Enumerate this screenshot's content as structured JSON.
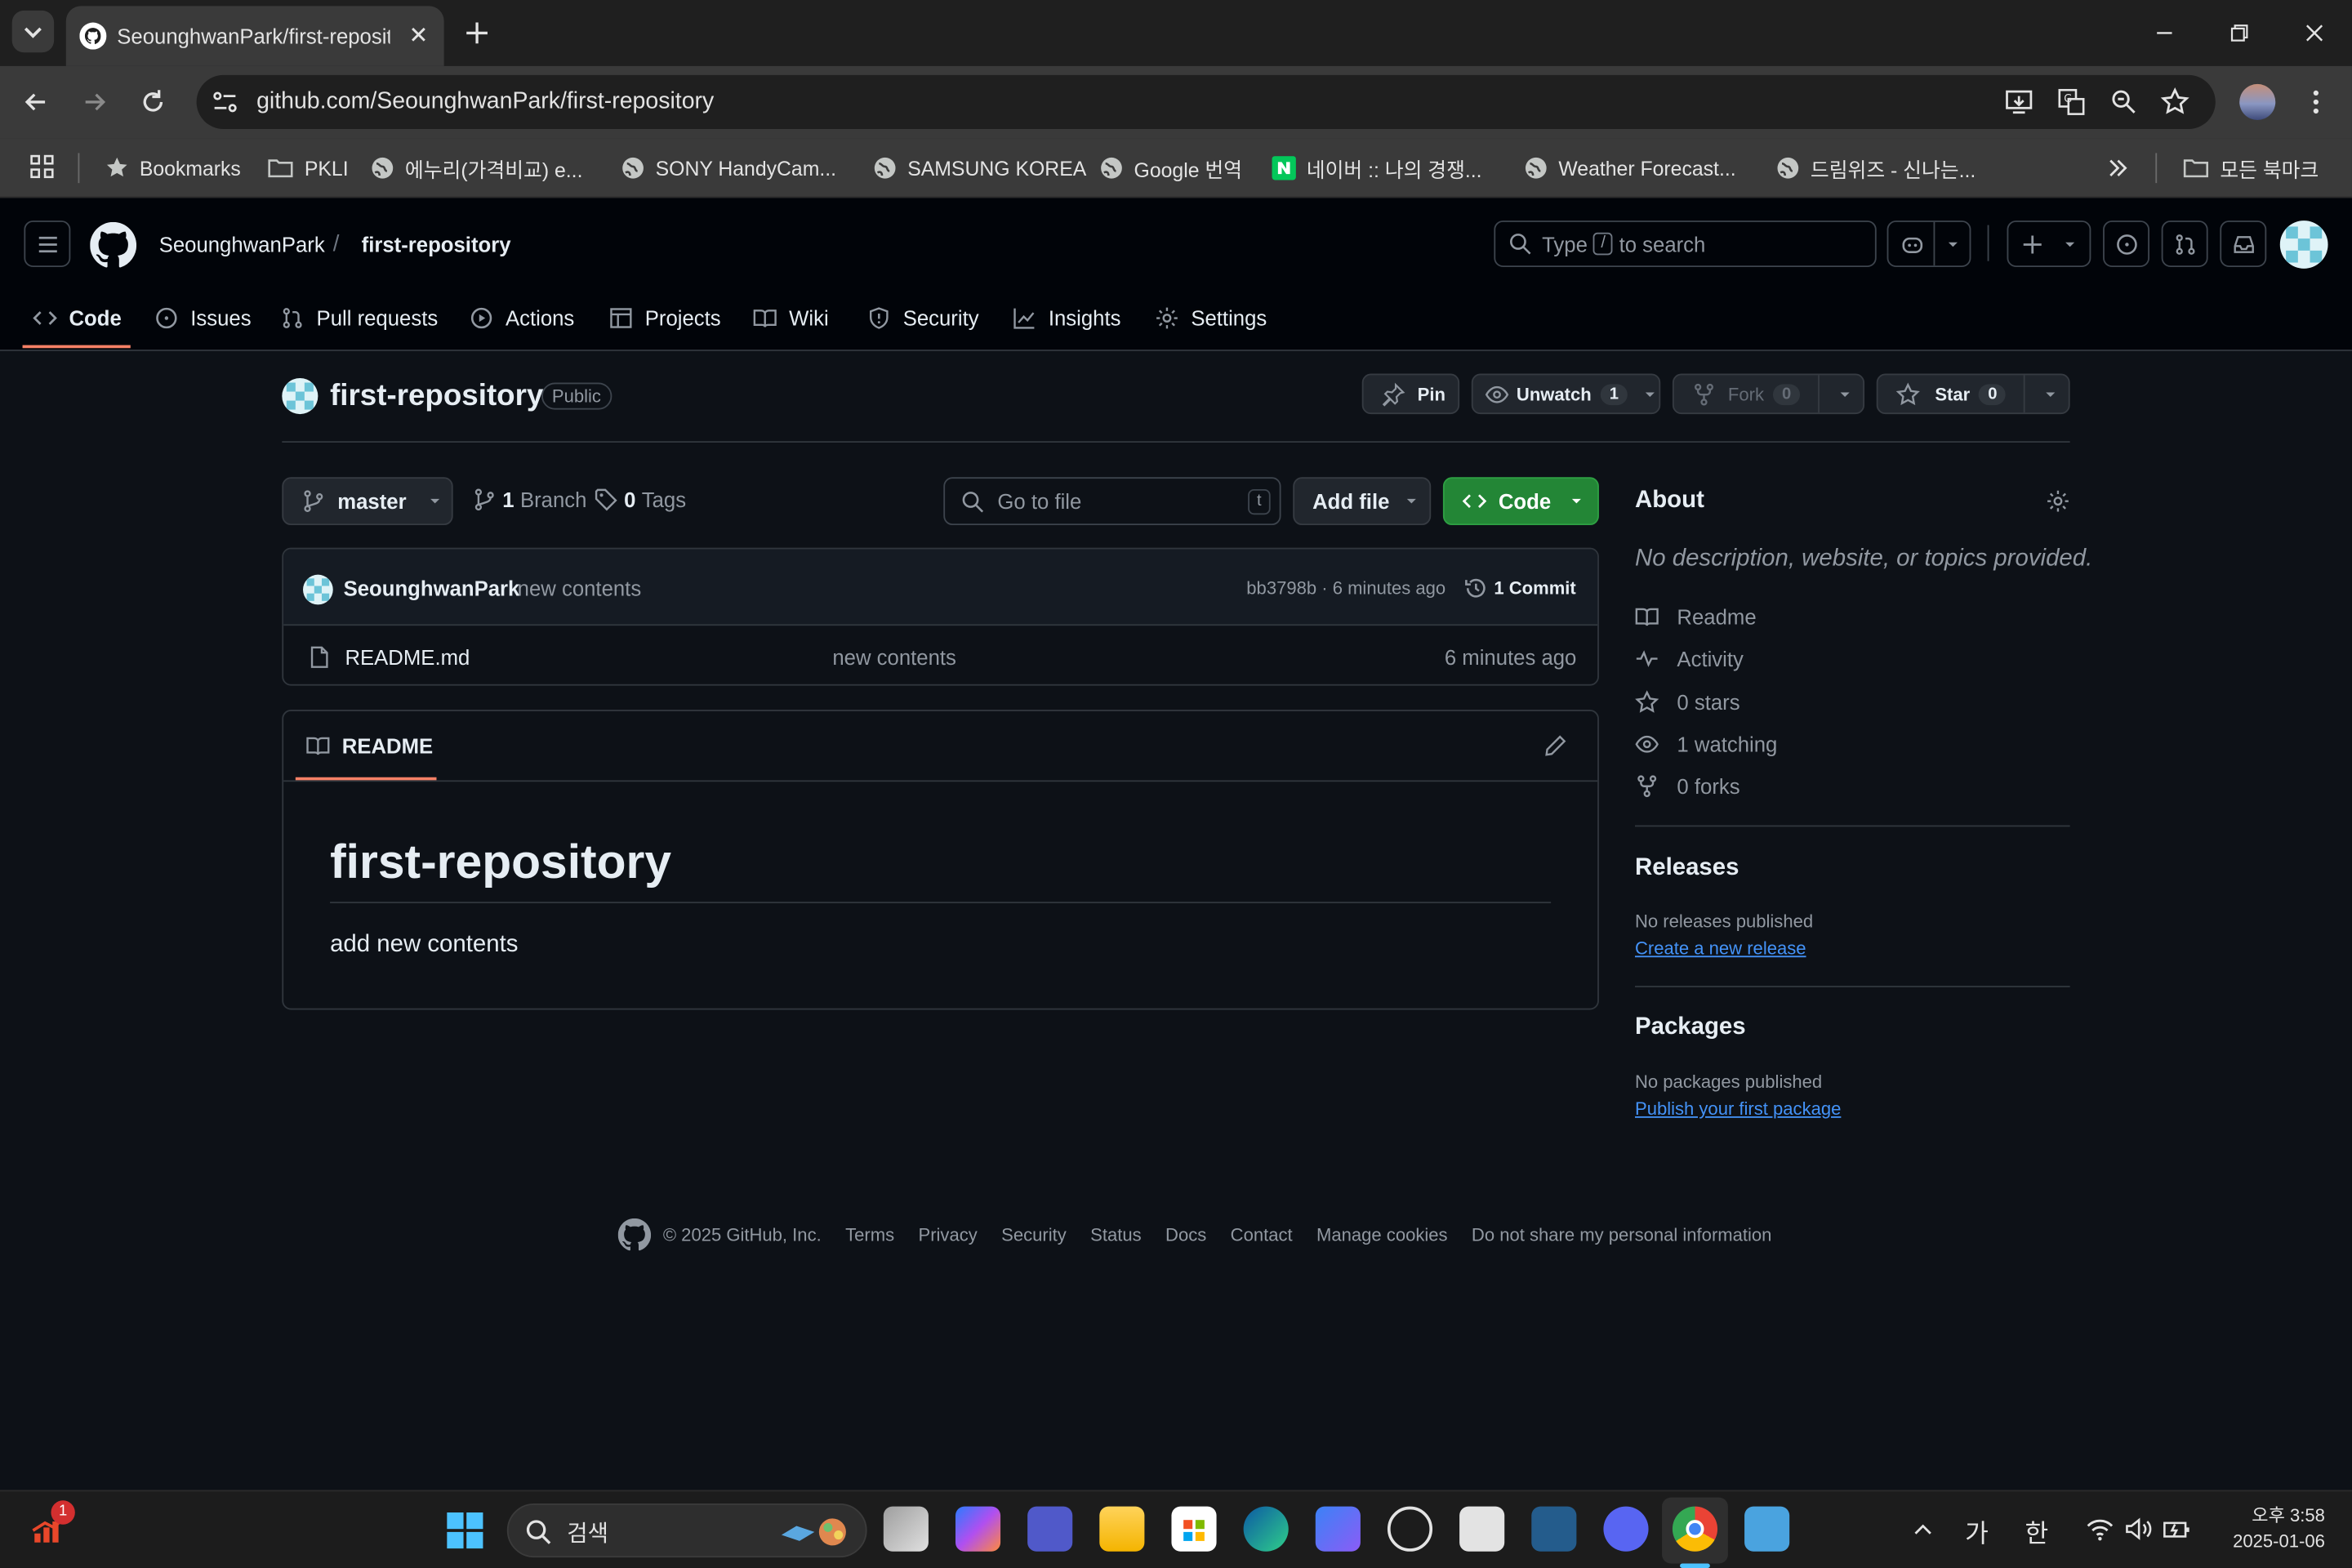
{
  "browser": {
    "tab_title": "SeounghwanPark/first-repository",
    "url": "github.com/SeounghwanPark/first-repository",
    "bookmarks": [
      {
        "label": "Bookmarks",
        "icon": "star-icon"
      },
      {
        "label": "PKLI",
        "icon": "folder-icon"
      },
      {
        "label": "에누리(가격비교) e...",
        "icon": "globe-icon"
      },
      {
        "label": "SONY HandyCam...",
        "icon": "globe-icon"
      },
      {
        "label": "SAMSUNG KOREA",
        "icon": "globe-icon"
      },
      {
        "label": "Google 번역",
        "icon": "globe-icon"
      },
      {
        "label": "네이버 :: 나의 경쟁...",
        "icon": "naver-icon"
      },
      {
        "label": "Weather Forecast...",
        "icon": "globe-icon"
      },
      {
        "label": "드림위즈 - 신나는...",
        "icon": "globe-icon"
      }
    ],
    "all_bookmarks": "모든 북마크"
  },
  "github": {
    "owner": "SeounghwanPark",
    "repo": "first-repository",
    "search_placeholder_pre": "Type",
    "search_key": "/",
    "search_placeholder_post": "to search",
    "tabs": [
      "Code",
      "Issues",
      "Pull requests",
      "Actions",
      "Projects",
      "Wiki",
      "Security",
      "Insights",
      "Settings"
    ],
    "visibility": "Public",
    "pin": "Pin",
    "unwatch": "Unwatch",
    "watch_count": "1",
    "fork": "Fork",
    "fork_count": "0",
    "star": "Star",
    "star_count": "0",
    "branch": "master",
    "branch_count": "1",
    "branch_label": "Branch",
    "tag_count": "0",
    "tag_label": "Tags",
    "goto_file": "Go to file",
    "goto_key": "t",
    "add_file": "Add file",
    "code_btn": "Code",
    "commit": {
      "author": "SeounghwanPark",
      "message": "new contents",
      "hash_time": "bb3798b · 6 minutes ago",
      "commits": "1 Commit"
    },
    "files": [
      {
        "name": "README.md",
        "message": "new contents",
        "time": "6 minutes ago"
      }
    ],
    "readme": {
      "tab": "README",
      "heading": "first-repository",
      "body": "add new contents"
    },
    "about": {
      "title": "About",
      "description": "No description, website, or topics provided.",
      "items": [
        {
          "icon": "book-icon",
          "label": "Readme"
        },
        {
          "icon": "pulse-icon",
          "label": "Activity"
        },
        {
          "icon": "star-icon",
          "label": "0 stars"
        },
        {
          "icon": "eye-icon",
          "label": "1 watching"
        },
        {
          "icon": "fork-icon",
          "label": "0 forks"
        }
      ]
    },
    "releases": {
      "title": "Releases",
      "text": "No releases published",
      "link": "Create a new release"
    },
    "packages": {
      "title": "Packages",
      "text": "No packages published",
      "link": "Publish your first package"
    },
    "footer": {
      "copyright": "© 2025 GitHub, Inc.",
      "links": [
        "Terms",
        "Privacy",
        "Security",
        "Status",
        "Docs",
        "Contact",
        "Manage cookies",
        "Do not share my personal information"
      ]
    }
  },
  "taskbar": {
    "search": "검색",
    "notification_count": "1",
    "ime_1": "가",
    "ime_2": "한",
    "time": "오후 3:58",
    "date": "2025-01-06"
  }
}
